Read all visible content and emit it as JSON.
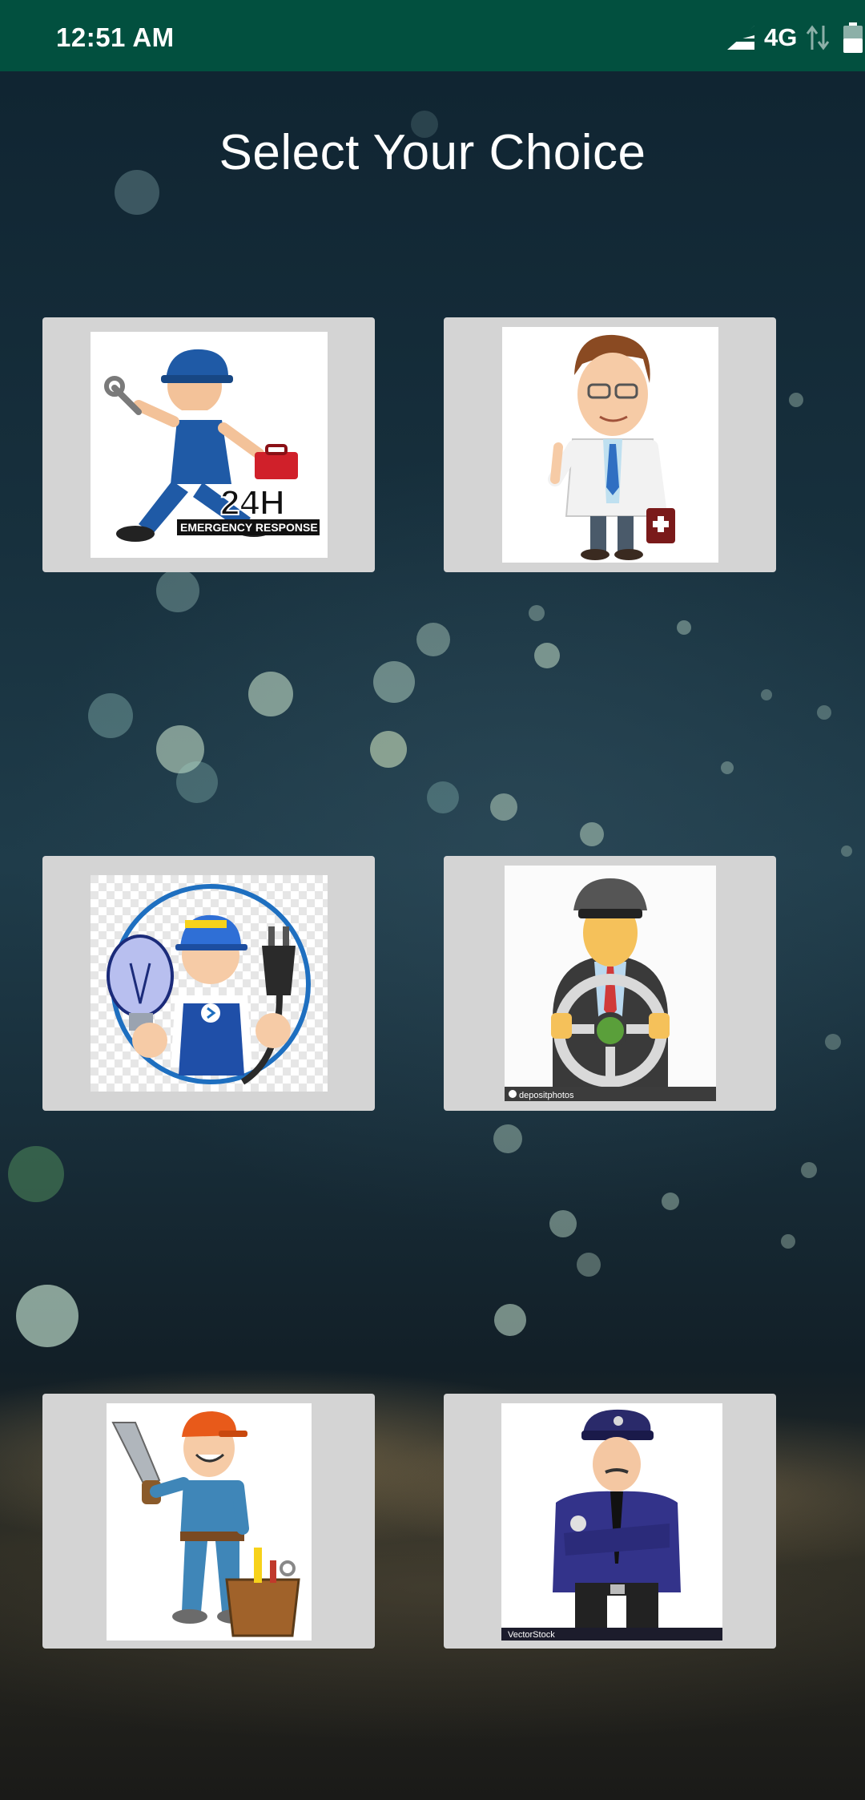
{
  "status_bar": {
    "time": "12:51 AM",
    "network": "4G",
    "icons": [
      "signal-icon",
      "data-arrows-icon",
      "battery-icon"
    ]
  },
  "page": {
    "title": "Select Your Choice"
  },
  "choices": [
    {
      "id": "plumber",
      "icon": "plumber-illustration",
      "image_text": "24H",
      "image_subtext": "EMERGENCY RESPONSE"
    },
    {
      "id": "doctor",
      "icon": "doctor-illustration"
    },
    {
      "id": "electrician",
      "icon": "electrician-illustration"
    },
    {
      "id": "driver",
      "icon": "driver-illustration",
      "image_text": "depositphotos"
    },
    {
      "id": "carpenter",
      "icon": "carpenter-illustration"
    },
    {
      "id": "police",
      "icon": "police-illustration",
      "image_text": "VectorStock"
    }
  ],
  "colors": {
    "status_bar": "#02503f",
    "card": "#d4d4d4",
    "title": "#ffffff"
  }
}
